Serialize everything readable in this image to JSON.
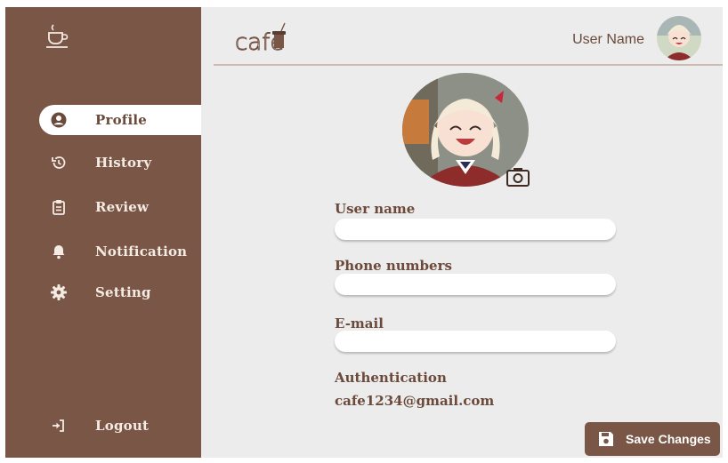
{
  "app": {
    "brand_text": "cafe"
  },
  "sidebar": {
    "items": [
      {
        "label": "Profile",
        "icon": "user-circle-icon",
        "active": true
      },
      {
        "label": "History",
        "icon": "history-icon"
      },
      {
        "label": "Review",
        "icon": "clipboard-icon"
      },
      {
        "label": "Notification",
        "icon": "bell-icon"
      },
      {
        "label": "Setting",
        "icon": "gear-icon"
      }
    ],
    "logout_label": "Logout",
    "logo_icon": "coffee-cup-icon"
  },
  "header": {
    "user_name": "User Name",
    "avatar_icon": "avatar"
  },
  "profile": {
    "avatar_icon": "profile-avatar",
    "camera_icon": "camera-icon",
    "fields": [
      {
        "label": "User name",
        "value": ""
      },
      {
        "label": "Phone numbers",
        "value": ""
      },
      {
        "label": "E-mail",
        "value": ""
      }
    ],
    "authentication_label": "Authentication",
    "authentication_value": "cafe1234@gmail.com"
  },
  "actions": {
    "save_label": "Save Changes",
    "save_icon": "floppy-disk-icon"
  },
  "colors": {
    "sidebar": "#7a5646",
    "background": "#ececec",
    "text": "#6b4a3b",
    "active_bg": "#ffffff"
  }
}
